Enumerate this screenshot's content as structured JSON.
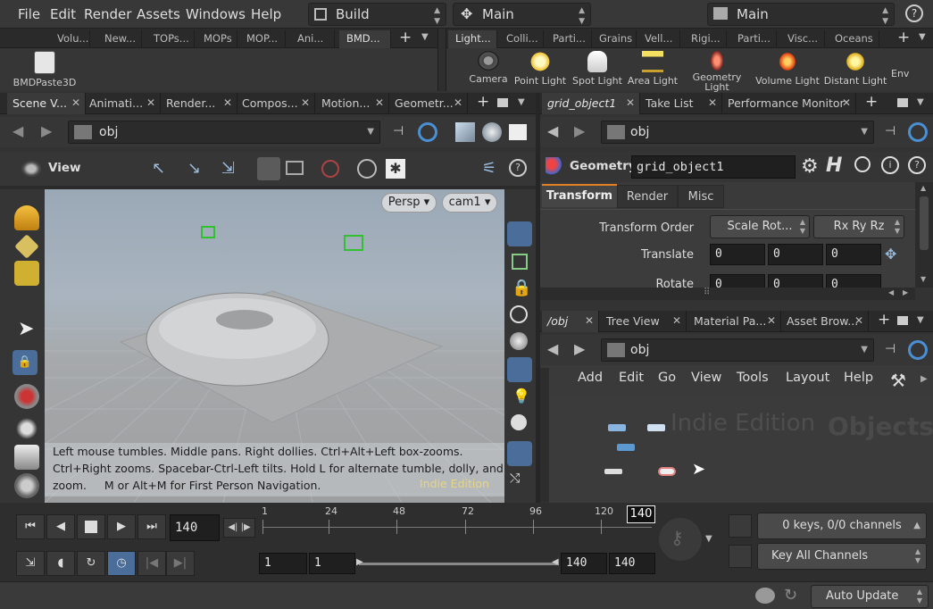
{
  "menubar": {
    "items": [
      "File",
      "Edit",
      "Render",
      "Assets",
      "Windows",
      "Help"
    ],
    "desktop": "Build",
    "context": "Main",
    "network_context": "Main"
  },
  "shelf_left": {
    "tabs": [
      "Volu...",
      "New...",
      "TOPs...",
      "MOPs",
      "MOP...",
      "Ani...",
      "BMD..."
    ],
    "tool": "BMDPaste3D"
  },
  "shelf_right": {
    "tabs": [
      "Light...",
      "Colli...",
      "Parti...",
      "Grains",
      "Vell...",
      "Rigi...",
      "Parti...",
      "Visc...",
      "Oceans"
    ],
    "tools": [
      "Camera",
      "Point Light",
      "Spot Light",
      "Area Light",
      "Geometry Light",
      "Volume Light",
      "Distant Light",
      "Env"
    ]
  },
  "viewer": {
    "tabs": [
      "Scene V...",
      "Animati...",
      "Render...",
      "Compos...",
      "Motion...",
      "Geometr..."
    ],
    "path": "obj",
    "title": "View",
    "persp": "Persp",
    "camera": "cam1",
    "hud_lines": [
      "Left mouse tumbles. Middle pans. Right dollies. Ctrl+Alt+Left box-zooms.",
      "Ctrl+Right zooms. Spacebar-Ctrl-Left tilts. Hold L for alternate tumble, dolly, and",
      "zoom.     M or Alt+M for First Person Navigation."
    ],
    "watermark": "Indie Edition"
  },
  "params": {
    "tabs": [
      "grid_object1",
      "Take List",
      "Performance Monitor"
    ],
    "path": "obj",
    "type": "Geometry",
    "name": "grid_object1",
    "subtabs": [
      "Transform",
      "Render",
      "Misc"
    ],
    "transform_order_label": "Transform Order",
    "transform_order": "Scale Rot...",
    "rotate_order": "Rx Ry Rz",
    "translate_label": "Translate",
    "translate": [
      "0",
      "0",
      "0"
    ],
    "rotate_label": "Rotate",
    "rotate": [
      "0",
      "0",
      "0"
    ]
  },
  "network": {
    "tabs": [
      "/obj",
      "Tree View",
      "Material Pa...",
      "Asset Brow..."
    ],
    "path": "obj",
    "menus": [
      "Add",
      "Edit",
      "Go",
      "View",
      "Tools",
      "Layout",
      "Help"
    ],
    "watermark": "Indie Edition",
    "context_label": "Objects"
  },
  "timeline": {
    "frame": "140",
    "ticks": [
      "1",
      "24",
      "48",
      "72",
      "96",
      "120"
    ],
    "current_marker": "140",
    "start": "1",
    "range_start": "1",
    "range_end": "140",
    "end": "140",
    "keys_info": "0 keys, 0/0 channels",
    "key_all": "Key All Channels",
    "update_mode": "Auto Update"
  }
}
